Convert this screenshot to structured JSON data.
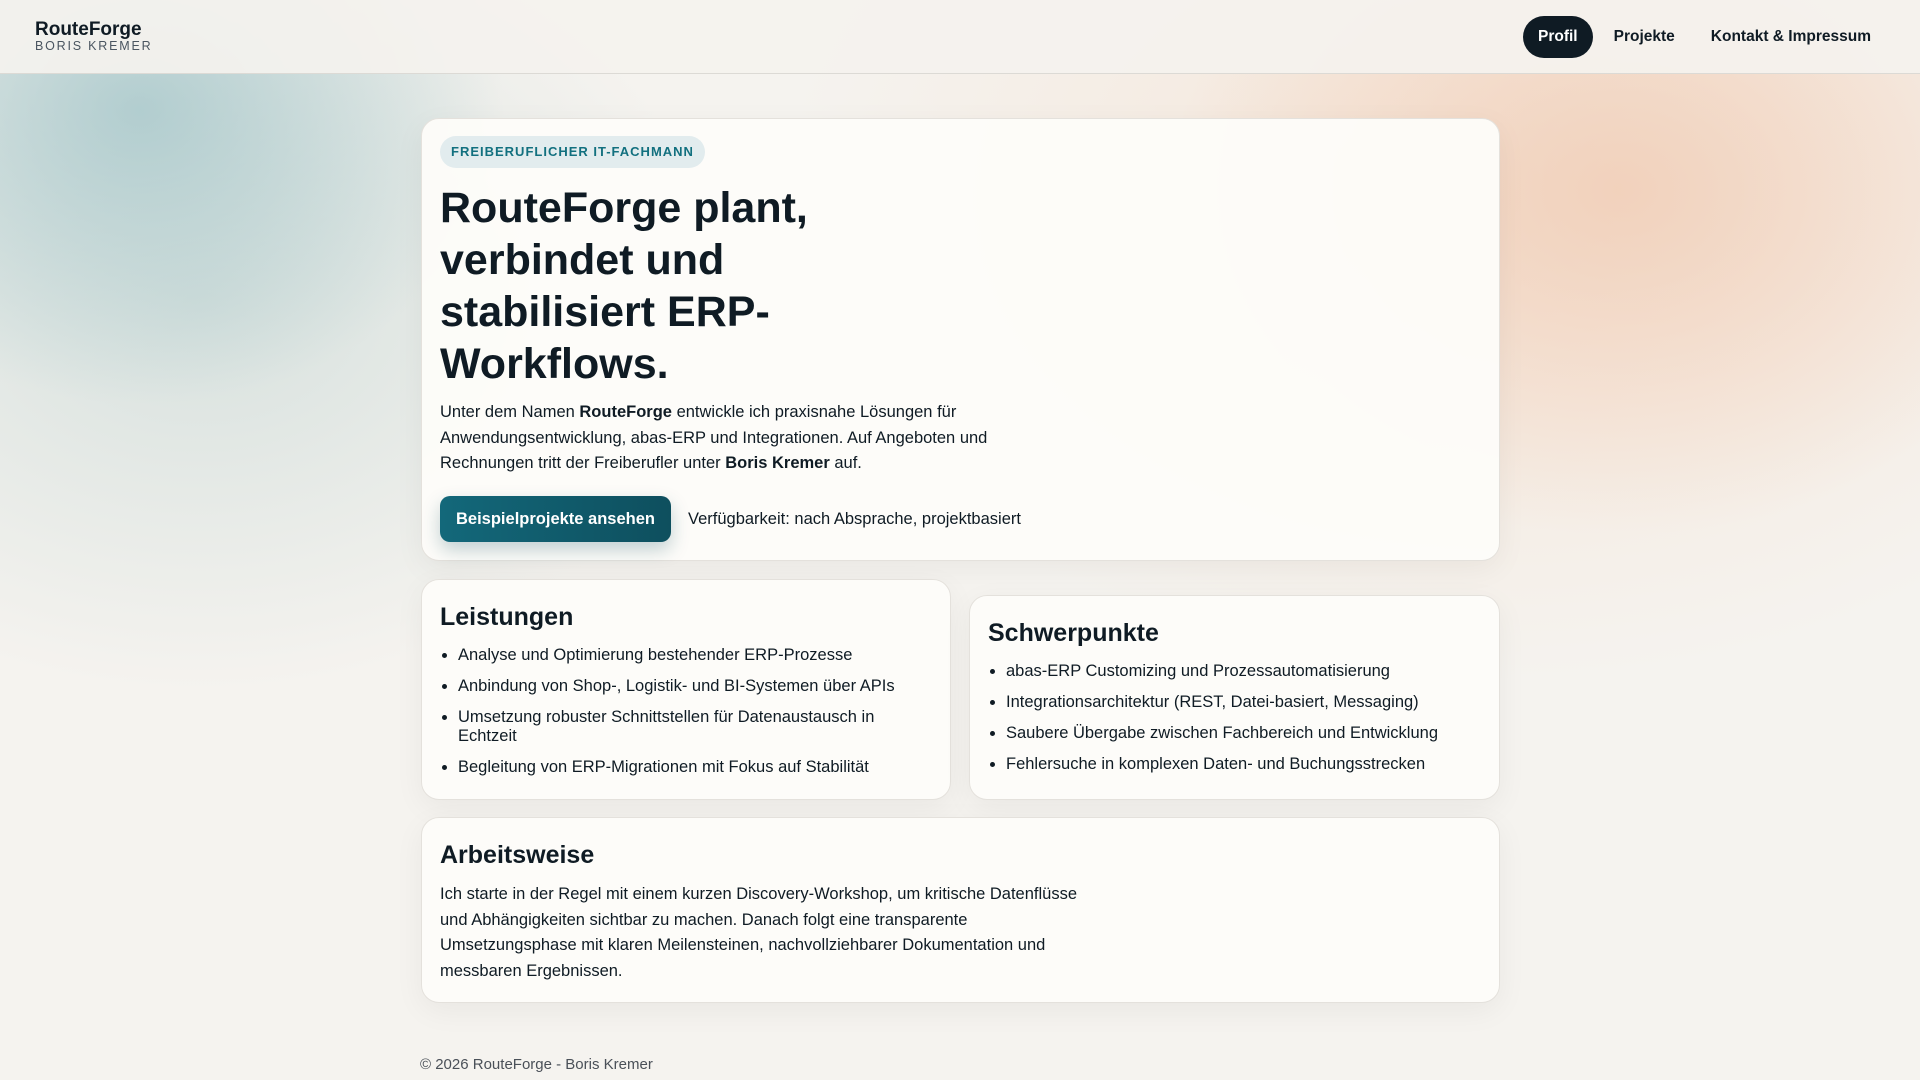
{
  "header": {
    "brand": "RouteForge",
    "subtitle": "BORIS KREMER",
    "nav": [
      {
        "label": "Profil",
        "active": true
      },
      {
        "label": "Projekte"
      },
      {
        "label": "Kontakt & Impressum"
      }
    ]
  },
  "hero": {
    "badge": "FREIBERUFLICHER IT-FACHMANN",
    "title": "RouteForge plant, verbindet und stabilisiert ERP-Workflows.",
    "lead": {
      "p1": "Unter dem Namen ",
      "b1": "RouteForge",
      "p2": " entwickle ich praxisnahe Lösungen für Anwendungsentwicklung, abas-ERP und Integrationen. Auf Angeboten und Rechnungen tritt der Freiberufler unter ",
      "b2": "Boris Kremer",
      "p3": " auf."
    },
    "cta": "Beispielprojekte ansehen",
    "availability": "Verfügbarkeit: nach Absprache, projektbasiert"
  },
  "leistungen": {
    "title": "Leistungen",
    "items": [
      "Analyse und Optimierung bestehender ERP-Prozesse",
      "Anbindung von Shop-, Logistik- und BI-Systemen über APIs",
      "Umsetzung robuster Schnittstellen für Datenaustausch in Echtzeit",
      "Begleitung von ERP-Migrationen mit Fokus auf Stabilität"
    ]
  },
  "schwerpunkte": {
    "title": "Schwerpunkte",
    "items": [
      "abas-ERP Customizing und Prozessautomatisierung",
      "Integrationsarchitektur (REST, Datei-basiert, Messaging)",
      "Saubere Übergabe zwischen Fachbereich und Entwicklung",
      "Fehlersuche in komplexen Daten- und Buchungsstrecken"
    ]
  },
  "arbeitsweise": {
    "title": "Arbeitsweise",
    "text": "Ich starte in der Regel mit einem kurzen Discovery-Workshop, um kritische Datenflüsse und Abhängigkeiten sichtbar zu machen. Danach folgt eine transparente Umsetzungsphase mit klaren Meilensteinen, nachvollziehbarer Dokumentation und messbaren Ergebnissen."
  },
  "footer": "© 2026 RouteForge - Boris Kremer",
  "colors": {
    "accent": "#13687a",
    "dark": "#0f1b24"
  }
}
